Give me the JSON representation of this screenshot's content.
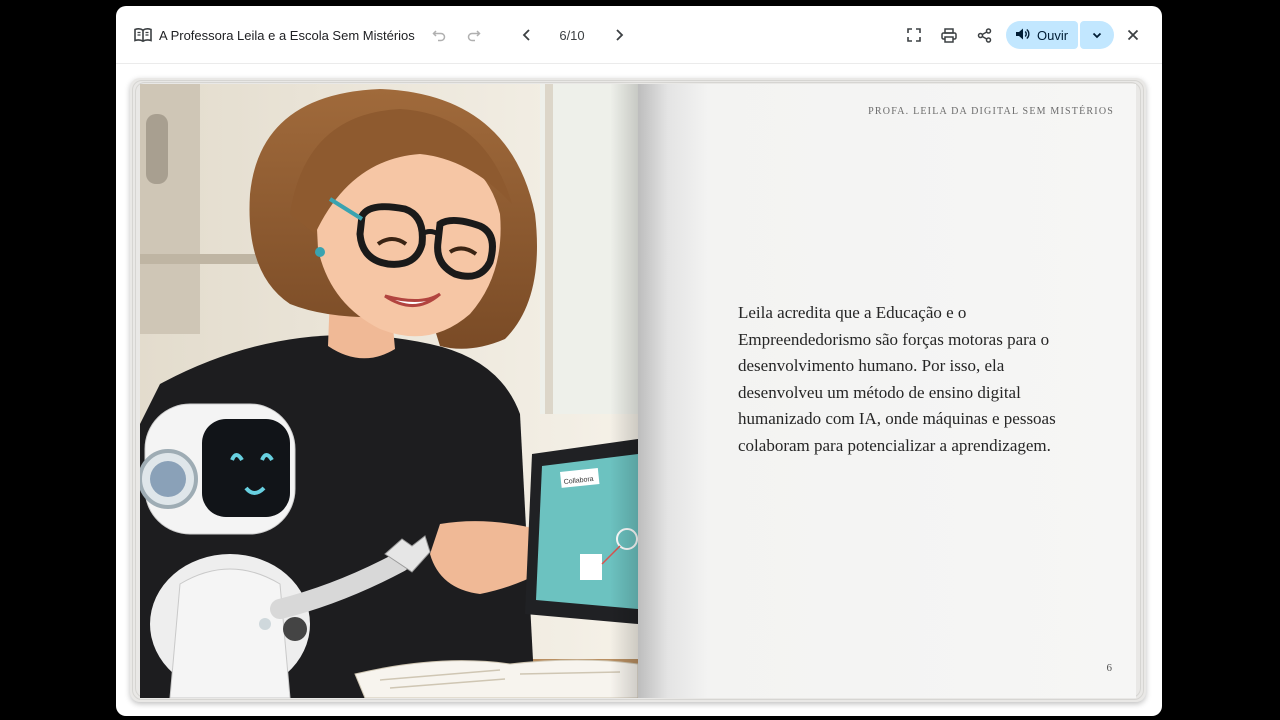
{
  "toolbar": {
    "title": "A Professora Leila e a Escola Sem Mistérios",
    "page_indicator": "6/10",
    "listen_label": "Ouvir",
    "icons": {
      "book": "book-open-icon",
      "undo": "undo-icon",
      "redo": "redo-icon",
      "prev": "chevron-left-icon",
      "next": "chevron-right-icon",
      "fullscreen": "fullscreen-icon",
      "print": "print-icon",
      "share": "share-icon",
      "speaker": "speaker-icon",
      "dropdown": "chevron-down-icon",
      "close": "close-icon"
    },
    "accent_color": "#c2e7ff"
  },
  "book": {
    "right_page": {
      "running_head": "Profa. Leila da Digital Sem Mistérios",
      "body": "Leila acredita que a Educação e o Empreendedorismo são forças motoras para o desenvolvimento humano. Por isso, ela desenvolveu um método de ensino digital humanizado com IA, onde máquinas e pessoas colaboram para potencializar a aprendizagem.",
      "page_number": "6"
    },
    "left_page": {
      "tablet_label": "Collabora"
    }
  }
}
